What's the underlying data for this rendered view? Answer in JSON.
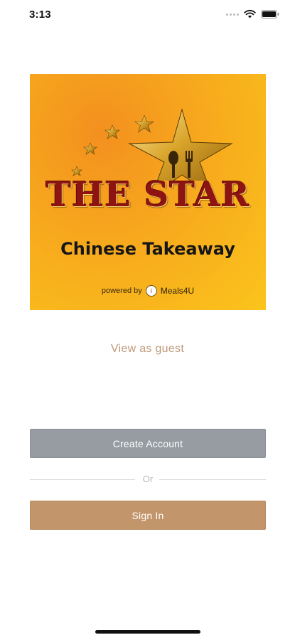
{
  "status_bar": {
    "time": "3:13",
    "icons": [
      "cellular-dots-icon",
      "wifi-icon",
      "battery-icon"
    ]
  },
  "logo": {
    "brand_name": "THE STAR",
    "subtitle": "Chinese Takeaway",
    "powered_by": "powered by",
    "partner": "Meals4U",
    "colors": {
      "gradient_start": "#f3901f",
      "gradient_end": "#fbc41c",
      "brand_text": "#8e1414",
      "star_gold": "#d9a42a"
    }
  },
  "guest_link": "View as guest",
  "buttons": {
    "create_account": "Create Account",
    "divider": "Or",
    "sign_in": "Sign In"
  },
  "colors": {
    "create_button": "#979ca2",
    "signin_button": "#c2956a",
    "guest_link": "#bf9a78"
  }
}
